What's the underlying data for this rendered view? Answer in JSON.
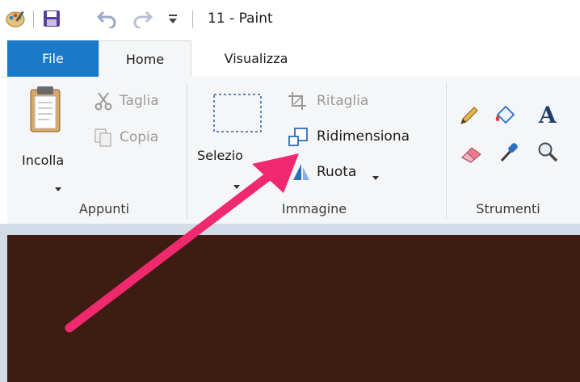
{
  "window": {
    "title": "11 - Paint"
  },
  "quick_access": {
    "icons": [
      "paint-app-icon",
      "save-icon",
      "undo-icon",
      "redo-icon",
      "customize-qat-icon"
    ]
  },
  "tabs": [
    {
      "label": "File",
      "active": false
    },
    {
      "label": "Home",
      "active": true
    },
    {
      "label": "Visualizza",
      "active": false
    }
  ],
  "ribbon": {
    "clipboard": {
      "paste_label": "Incolla",
      "cut_label": "Taglia",
      "copy_label": "Copia",
      "group_label": "Appunti"
    },
    "image": {
      "select_label": "Selezio",
      "crop_label": "Ritaglia",
      "resize_label": "Ridimensiona",
      "rotate_label": "Ruota",
      "group_label": "Immagine"
    },
    "tools": {
      "group_label": "Strumenti",
      "icons": [
        "pencil-icon",
        "fill-icon",
        "text-icon",
        "eraser-icon",
        "color-picker-icon",
        "magnifier-icon"
      ]
    }
  },
  "colors": {
    "file_tab": "#1979ca",
    "ribbon_bg": "#f5f6f7",
    "canvas": "#3d1c12",
    "annotation_arrow": "#f0286e"
  }
}
